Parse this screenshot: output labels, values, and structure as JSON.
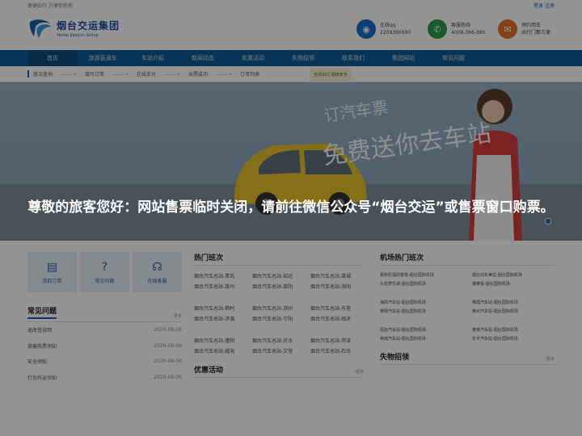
{
  "topbar": {
    "left": "便捷出行 方便你我他",
    "right_login": "登录",
    "right_register": "注册"
  },
  "logo": {
    "cn": "烟台交运集团",
    "en": "Yantai Jiaoyun Group"
  },
  "contacts": [
    {
      "icon": "qq-icon",
      "line1": "在线qq",
      "line2": "2209390690",
      "color": "#1b6bc6"
    },
    {
      "icon": "phone-icon",
      "line1": "客服热线",
      "line2": "4008-366-365",
      "color": "#2a9a4a"
    },
    {
      "icon": "chat-icon",
      "line1": "预约用车",
      "line2": "出行门都方便",
      "color": "#e2742a"
    }
  ],
  "nav": [
    "首页",
    "旅游直通车",
    "车站介绍",
    "新闻动态",
    "优惠活动",
    "失物招领",
    "联系我们",
    "集团网站",
    "常见问题"
  ],
  "steps": [
    "班次查询",
    "填写订单",
    "在线支付",
    "出票成功",
    "订单列表"
  ],
  "banner": {
    "line1": "订汽车票",
    "line2": "免费送你去车站",
    "sign": "自驾出行 便捷安全"
  },
  "notice": "尊敬的旅客您好：网站售票临时关闭，请前往微信公众号“烟台交运”或售票窗口购票。",
  "quick": [
    {
      "icon": "order-icon",
      "label": "我的订单"
    },
    {
      "icon": "question-icon",
      "label": "常见问题"
    },
    {
      "icon": "headset-icon",
      "label": "在线客服"
    }
  ],
  "faq": {
    "title": "常见问题",
    "more": "更多",
    "items": [
      {
        "title": "退改签说明",
        "date": "2020-08-06"
      },
      {
        "title": "旅客购票须知",
        "date": "2020-08-06"
      },
      {
        "title": "安全须知",
        "date": "2020-08-06"
      },
      {
        "title": "行包托运须知",
        "date": "2020-08-06"
      }
    ]
  },
  "hot_routes": {
    "title": "热门班次",
    "groups": [
      [
        "烟台汽车总站-青岛",
        "烟台汽车总站-招远",
        "烟台汽车总站-莱城",
        "烟台汽车总站-莱州",
        "烟台汽车总站-莱阳",
        "烟台汽车总站-海阳"
      ],
      [
        "烟台汽车总站-栖村",
        "烟台汽车总站-滨州",
        "烟台汽车总站-东营",
        "烟台汽车总站-济源",
        "烟台汽车总站-宁阳",
        "烟台汽车总站-临沭"
      ],
      [
        "烟台汽车总站-蓬阳",
        "烟台汽车总站-沂水",
        "烟台汽车总站-菏泽",
        "烟台汽车总站-威海",
        "烟台汽车总站-文登",
        "烟台汽车总站-石岛"
      ]
    ]
  },
  "promo": {
    "title": "优惠活动",
    "more": "更多"
  },
  "airport": {
    "title": "机场热门班次",
    "groups": [
      [
        "幕斯臣福前客栈-烟台国际机场",
        "烟台幼车美站-烟台国际机场",
        "头软梦乐城-烟台国际机场",
        "蓬莱客-烟台国际机场"
      ],
      [
        "海阳汽车站-烟台国际机场",
        "栖霞汽车站-烟台国际机场",
        "莱阳汽车站-烟台国际机场",
        "莱州汽车站-烟台国际机场"
      ],
      [
        "招远汽车站-烟台国际机场",
        "蓬莱汽车站-烟台国际机场",
        "黄城汽车站-烟台国际机场",
        "牟平汽车站-烟台国际机场"
      ]
    ]
  },
  "lost": {
    "title": "失物招领",
    "more": "更多"
  }
}
